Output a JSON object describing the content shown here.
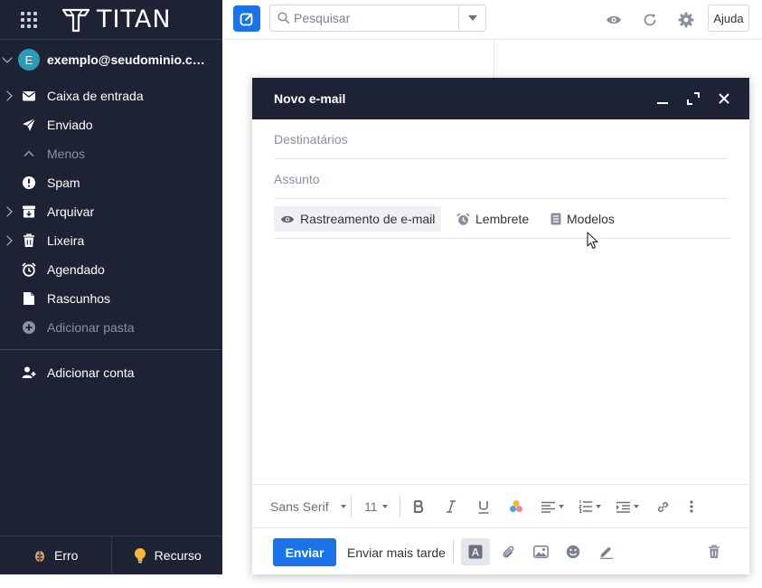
{
  "app": {
    "brand": "TITAN"
  },
  "account": {
    "initial": "E",
    "email": "exemplo@seudominio.co..."
  },
  "folders": [
    {
      "label": "Caixa de entrada",
      "icon": "envelope-icon",
      "expandable": true,
      "muted": false
    },
    {
      "label": "Enviado",
      "icon": "send-icon",
      "expandable": false,
      "muted": false
    },
    {
      "label": "Menos",
      "icon": "chevron-up-icon",
      "expandable": false,
      "muted": true
    },
    {
      "label": "Spam",
      "icon": "alert-icon",
      "expandable": false,
      "muted": false
    },
    {
      "label": "Arquivar",
      "icon": "archive-icon",
      "expandable": true,
      "muted": false
    },
    {
      "label": "Lixeira",
      "icon": "trash-icon",
      "expandable": true,
      "muted": false
    },
    {
      "label": "Agendado",
      "icon": "alarm-icon",
      "expandable": false,
      "muted": false
    },
    {
      "label": "Rascunhos",
      "icon": "draft-icon",
      "expandable": false,
      "muted": false
    },
    {
      "label": "Adicionar pasta",
      "icon": "add-folder-icon",
      "expandable": false,
      "muted": true
    }
  ],
  "add_account_label": "Adicionar conta",
  "sidebar_bottom": {
    "error_label": "Erro",
    "feature_label": "Recurso"
  },
  "topbar": {
    "search_placeholder": "Pesquisar",
    "help_label": "Ajuda"
  },
  "compose": {
    "title": "Novo e-mail",
    "to_placeholder": "Destinatários",
    "subject_placeholder": "Assunto",
    "options": {
      "tracking_label": "Rastreamento de e-mail",
      "reminder_label": "Lembrete",
      "templates_label": "Modelos"
    },
    "toolbar": {
      "font_family": "Sans Serif",
      "font_size": "11"
    },
    "footer": {
      "send_label": "Enviar",
      "send_later_label": "Enviar mais tarde",
      "format_glyph": "A"
    }
  },
  "colors": {
    "sidebar_bg": "#1e2235",
    "accent": "#1a73e8",
    "avatar": "#2b9bb7"
  }
}
